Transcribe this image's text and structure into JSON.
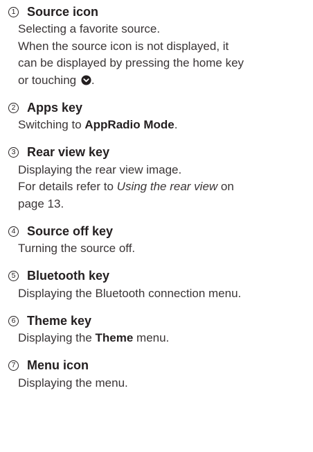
{
  "items": [
    {
      "number": "1",
      "title": "Source icon",
      "lines": [
        "Selecting a favorite source.",
        "When the source icon is not displayed, it",
        "can be displayed by pressing the home key",
        "or touching"
      ],
      "icon": "chevron-down-circle-icon",
      "after_icon": "."
    },
    {
      "number": "2",
      "title": "Apps key",
      "text_before": "Switching to ",
      "bold": "AppRadio Mode",
      "text_after": "."
    },
    {
      "number": "3",
      "title": "Rear view key",
      "line1": "Displaying the rear view image.",
      "line2_before": "For details refer to ",
      "line2_italic": "Using the rear view",
      "line2_after": " on",
      "line3": "page 13."
    },
    {
      "number": "4",
      "title": "Source off key",
      "text": "Turning the source off."
    },
    {
      "number": "5",
      "title": "Bluetooth key",
      "text": "Displaying the Bluetooth connection menu."
    },
    {
      "number": "6",
      "title": "Theme key",
      "text_before": "Displaying the ",
      "bold": "Theme",
      "text_after": " menu."
    },
    {
      "number": "7",
      "title": "Menu icon",
      "text": "Displaying the menu."
    }
  ],
  "colors": {
    "text": "#231f20",
    "body_text": "#3a3536",
    "background": "#ffffff"
  }
}
